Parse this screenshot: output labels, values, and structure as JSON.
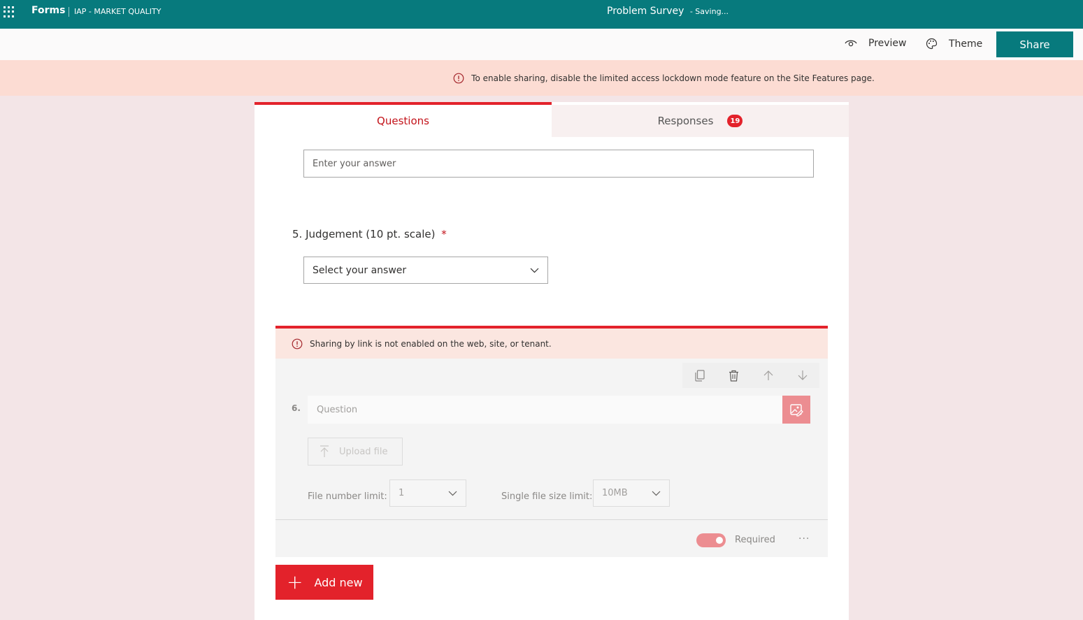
{
  "header": {
    "app_name": "Forms",
    "org_name": "IAP - MARKET QUALITY",
    "form_title": "Problem Survey",
    "save_status": "- Saving..."
  },
  "commands": {
    "preview_label": "Preview",
    "theme_label": "Theme",
    "share_label": "Share"
  },
  "banner": {
    "message": "To enable sharing, disable the limited access lockdown mode feature on the Site Features page."
  },
  "tabs": {
    "questions_label": "Questions",
    "responses_label": "Responses",
    "responses_count": "19"
  },
  "prev_question": {
    "answer_placeholder": "Enter your answer"
  },
  "question5": {
    "number": "5.",
    "title": "Judgement (10 pt. scale)",
    "required_mark": "*",
    "select_placeholder": "Select your answer"
  },
  "question6": {
    "warning": "Sharing by link is not enabled on the web, site, or tenant.",
    "number": "6.",
    "question_placeholder": "Question",
    "upload_label": "Upload file",
    "file_number_label": "File number limit:",
    "file_number_value": "1",
    "file_size_label": "Single file size limit:",
    "file_size_value": "10MB",
    "required_label": "Required",
    "more_label": "···"
  },
  "add_new_label": "Add new",
  "colors": {
    "brand_teal": "#077a7d",
    "accent_red": "#e3222b",
    "banner_bg": "#fcdcd3"
  }
}
